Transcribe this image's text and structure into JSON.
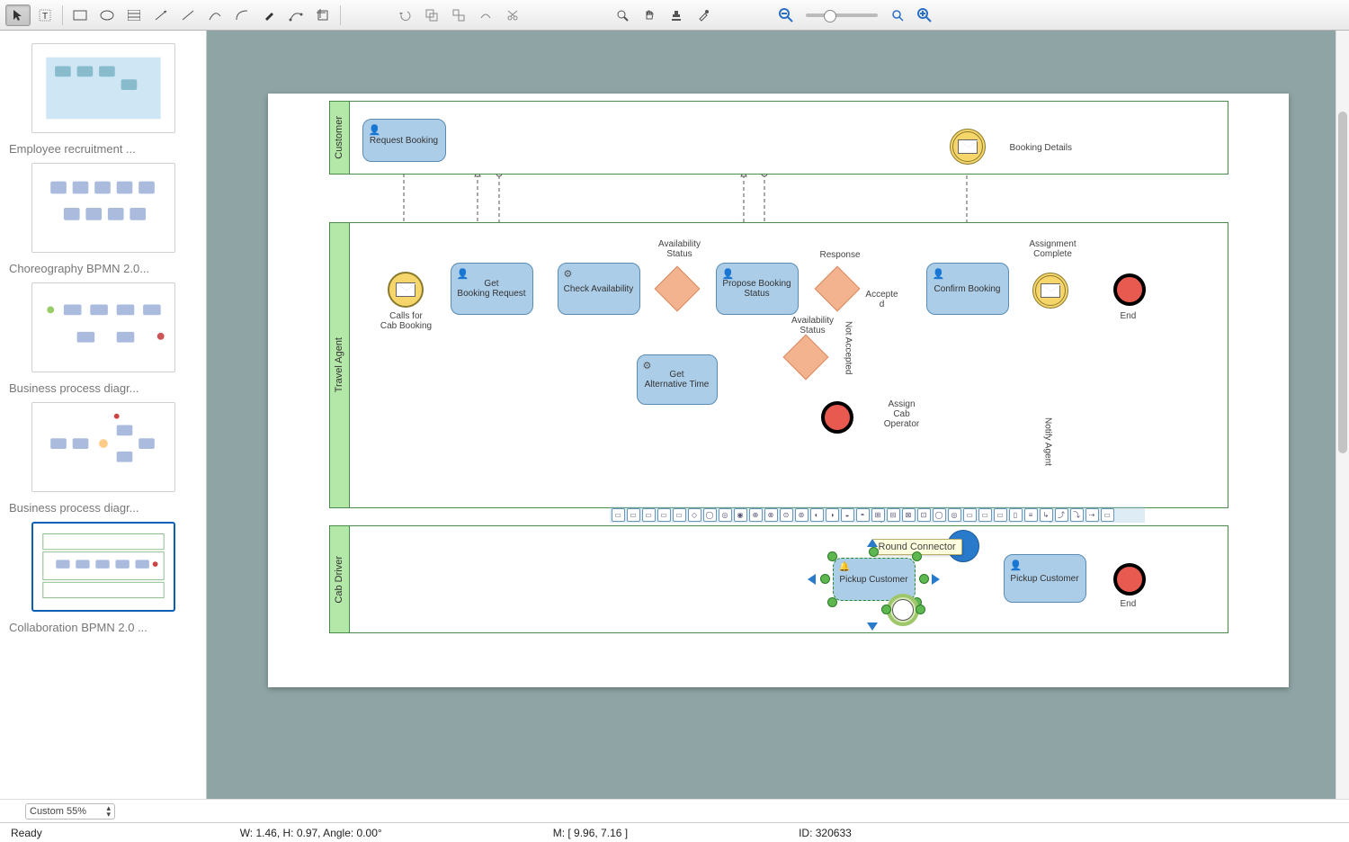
{
  "toolbar": {
    "tools": [
      "pointer",
      "text",
      "rect",
      "ellipse",
      "table",
      "connector",
      "line",
      "curve",
      "arc",
      "pen",
      "path-edit",
      "crop"
    ],
    "edit_tools": [
      "undo",
      "group",
      "ungroup",
      "path-op",
      "scissors"
    ],
    "view_tools": [
      "zoom",
      "hand",
      "stamp",
      "eyedropper"
    ],
    "zoom_tools": [
      "zoom-out",
      "zoom-slider",
      "zoom-fit",
      "zoom-in"
    ]
  },
  "sidebar": {
    "pages": [
      {
        "label": "Employee recruitment ..."
      },
      {
        "label": "Choreography BPMN 2.0..."
      },
      {
        "label": "Business process diagr..."
      },
      {
        "label": "Business process diagr..."
      },
      {
        "label": "Collaboration BPMN 2.0 ..."
      }
    ]
  },
  "canvas": {
    "pools": [
      {
        "name": "Customer"
      },
      {
        "name": "Travel Agent"
      },
      {
        "name": "Cab Driver"
      }
    ],
    "tasks": {
      "request_booking": "Request Booking",
      "booking_details": "Booking Details",
      "get_booking_request": "Get\nBooking Request",
      "check_availability": "Check Availability",
      "propose_booking_status": "Propose Booking\nStatus",
      "confirm_booking": "Confirm Booking",
      "get_alt_time": "Get\nAlternative Time",
      "pickup_customer_sel": "Pickup Customer",
      "pickup_customer2": "Pickup Customer"
    },
    "labels": {
      "calls": "Calls for\nCab Booking",
      "avail_status": "Availability\nStatus",
      "response": "Response",
      "accepted": "Accepte\nd",
      "avail_status2": "Availability\nStatus",
      "not_accepted": "Not Accepted",
      "assign_cab": "Assign\nCab\nOperator",
      "assignment_complete": "Assignment\nComplete",
      "notify_agent": "Notify Agent",
      "end": "End",
      "end2": "End"
    },
    "tooltip": "Round Connector"
  },
  "zoom_select": "Custom 55%",
  "statusbar": {
    "ready": "Ready",
    "dims": "W: 1.46,  H: 0.97,  Angle: 0.00°",
    "mouse": "M: [ 9.96, 7.16 ]",
    "id": "ID: 320633"
  }
}
